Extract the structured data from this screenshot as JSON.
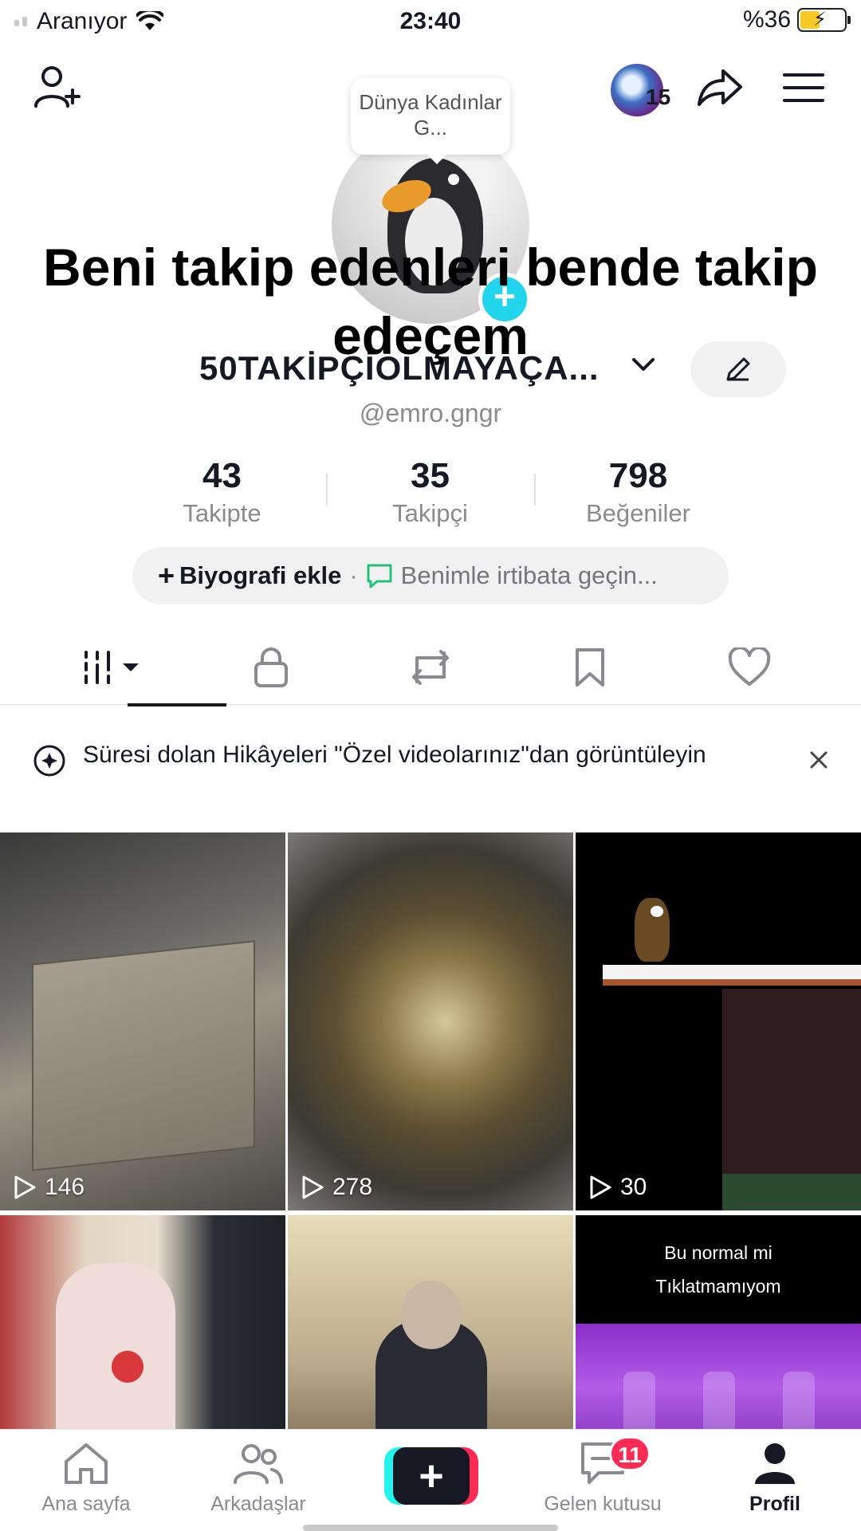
{
  "status_bar": {
    "carrier": "Aranıyor",
    "time": "23:40",
    "battery": "%36"
  },
  "top_bar": {
    "story_count": "15"
  },
  "profile": {
    "tooltip": "Dünya Kadınlar G...",
    "overlay_title": "Beni takip edenleri bende takip edeçem",
    "display_name": "50TAKİPÇİOLMAYAÇA...",
    "username": "@emro.gngr"
  },
  "stats": [
    {
      "value": "43",
      "label": "Takipte"
    },
    {
      "value": "35",
      "label": "Takipçi"
    },
    {
      "value": "798",
      "label": "Beğeniler"
    }
  ],
  "bio": {
    "add_label": "Biyografi ekle",
    "separator": "·",
    "contact_label": "Benimle irtibata geçin..."
  },
  "banner": {
    "text": "Süresi dolan Hikâyeleri \"Özel videolarınız\"dan görüntüleyin"
  },
  "videos": [
    {
      "views": "146"
    },
    {
      "views": "278"
    },
    {
      "views": "30"
    },
    {
      "views": ""
    },
    {
      "views": ""
    },
    {
      "views": "",
      "caption_line1": "Bu normal mi",
      "caption_line2": "Tıklatmamıyom"
    }
  ],
  "nav": {
    "home": "Ana sayfa",
    "friends": "Arkadaşlar",
    "inbox": "Gelen kutusu",
    "inbox_badge": "11",
    "profile": "Profil"
  },
  "colors": {
    "accent_cyan": "#20d5ec",
    "brand_red": "#fe2c55",
    "brand_cyan": "#25f4ee",
    "text_primary": "#161823",
    "text_secondary": "#8a8b91"
  }
}
